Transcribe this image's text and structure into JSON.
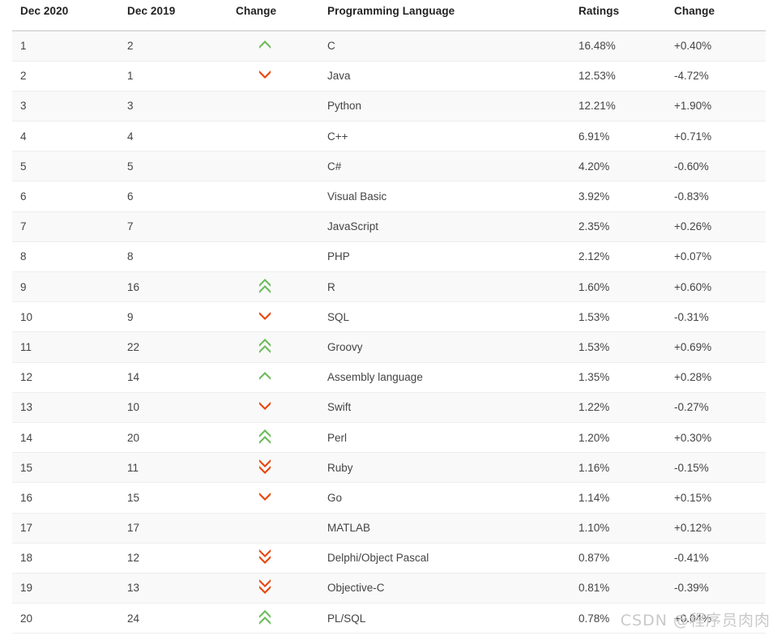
{
  "table": {
    "columns": [
      {
        "key": "rank_new",
        "label": "Dec 2020"
      },
      {
        "key": "rank_old",
        "label": "Dec 2019"
      },
      {
        "key": "change_arrow",
        "label": "Change"
      },
      {
        "key": "language",
        "label": "Programming Language"
      },
      {
        "key": "ratings",
        "label": "Ratings"
      },
      {
        "key": "change_pct",
        "label": "Change"
      }
    ],
    "rows": [
      {
        "rank_new": "1",
        "rank_old": "2",
        "arrow": "up",
        "language": "C",
        "ratings": "16.48%",
        "change_pct": "+0.40%"
      },
      {
        "rank_new": "2",
        "rank_old": "1",
        "arrow": "down",
        "language": "Java",
        "ratings": "12.53%",
        "change_pct": "-4.72%"
      },
      {
        "rank_new": "3",
        "rank_old": "3",
        "arrow": "none",
        "language": "Python",
        "ratings": "12.21%",
        "change_pct": "+1.90%"
      },
      {
        "rank_new": "4",
        "rank_old": "4",
        "arrow": "none",
        "language": "C++",
        "ratings": "6.91%",
        "change_pct": "+0.71%"
      },
      {
        "rank_new": "5",
        "rank_old": "5",
        "arrow": "none",
        "language": "C#",
        "ratings": "4.20%",
        "change_pct": "-0.60%"
      },
      {
        "rank_new": "6",
        "rank_old": "6",
        "arrow": "none",
        "language": "Visual Basic",
        "ratings": "3.92%",
        "change_pct": "-0.83%"
      },
      {
        "rank_new": "7",
        "rank_old": "7",
        "arrow": "none",
        "language": "JavaScript",
        "ratings": "2.35%",
        "change_pct": "+0.26%"
      },
      {
        "rank_new": "8",
        "rank_old": "8",
        "arrow": "none",
        "language": "PHP",
        "ratings": "2.12%",
        "change_pct": "+0.07%"
      },
      {
        "rank_new": "9",
        "rank_old": "16",
        "arrow": "double-up",
        "language": "R",
        "ratings": "1.60%",
        "change_pct": "+0.60%"
      },
      {
        "rank_new": "10",
        "rank_old": "9",
        "arrow": "down",
        "language": "SQL",
        "ratings": "1.53%",
        "change_pct": "-0.31%"
      },
      {
        "rank_new": "11",
        "rank_old": "22",
        "arrow": "double-up",
        "language": "Groovy",
        "ratings": "1.53%",
        "change_pct": "+0.69%"
      },
      {
        "rank_new": "12",
        "rank_old": "14",
        "arrow": "up",
        "language": "Assembly language",
        "ratings": "1.35%",
        "change_pct": "+0.28%"
      },
      {
        "rank_new": "13",
        "rank_old": "10",
        "arrow": "down",
        "language": "Swift",
        "ratings": "1.22%",
        "change_pct": "-0.27%"
      },
      {
        "rank_new": "14",
        "rank_old": "20",
        "arrow": "double-up",
        "language": "Perl",
        "ratings": "1.20%",
        "change_pct": "+0.30%"
      },
      {
        "rank_new": "15",
        "rank_old": "11",
        "arrow": "double-down",
        "language": "Ruby",
        "ratings": "1.16%",
        "change_pct": "-0.15%"
      },
      {
        "rank_new": "16",
        "rank_old": "15",
        "arrow": "down",
        "language": "Go",
        "ratings": "1.14%",
        "change_pct": "+0.15%"
      },
      {
        "rank_new": "17",
        "rank_old": "17",
        "arrow": "none",
        "language": "MATLAB",
        "ratings": "1.10%",
        "change_pct": "+0.12%"
      },
      {
        "rank_new": "18",
        "rank_old": "12",
        "arrow": "double-down",
        "language": "Delphi/Object Pascal",
        "ratings": "0.87%",
        "change_pct": "-0.41%"
      },
      {
        "rank_new": "19",
        "rank_old": "13",
        "arrow": "double-down",
        "language": "Objective-C",
        "ratings": "0.81%",
        "change_pct": "-0.39%"
      },
      {
        "rank_new": "20",
        "rank_old": "24",
        "arrow": "double-up",
        "language": "PL/SQL",
        "ratings": "0.78%",
        "change_pct": "+0.04%"
      }
    ]
  },
  "icons": {
    "up": "chevron-up-icon",
    "double-up": "chevron-double-up-icon",
    "down": "chevron-down-icon",
    "double-down": "chevron-double-down-icon",
    "none": "no-change-icon"
  },
  "colors": {
    "up": "#6cbb5a",
    "down": "#e8450a",
    "header_text": "#222222",
    "body_text": "#444444",
    "row_odd": "#f9f9f9",
    "row_even": "#ffffff",
    "header_border": "#dddddd",
    "row_border": "#eeeeee",
    "watermark": "#c9c9c9"
  },
  "watermark": {
    "text": "CSDN @程序员肉肉"
  }
}
